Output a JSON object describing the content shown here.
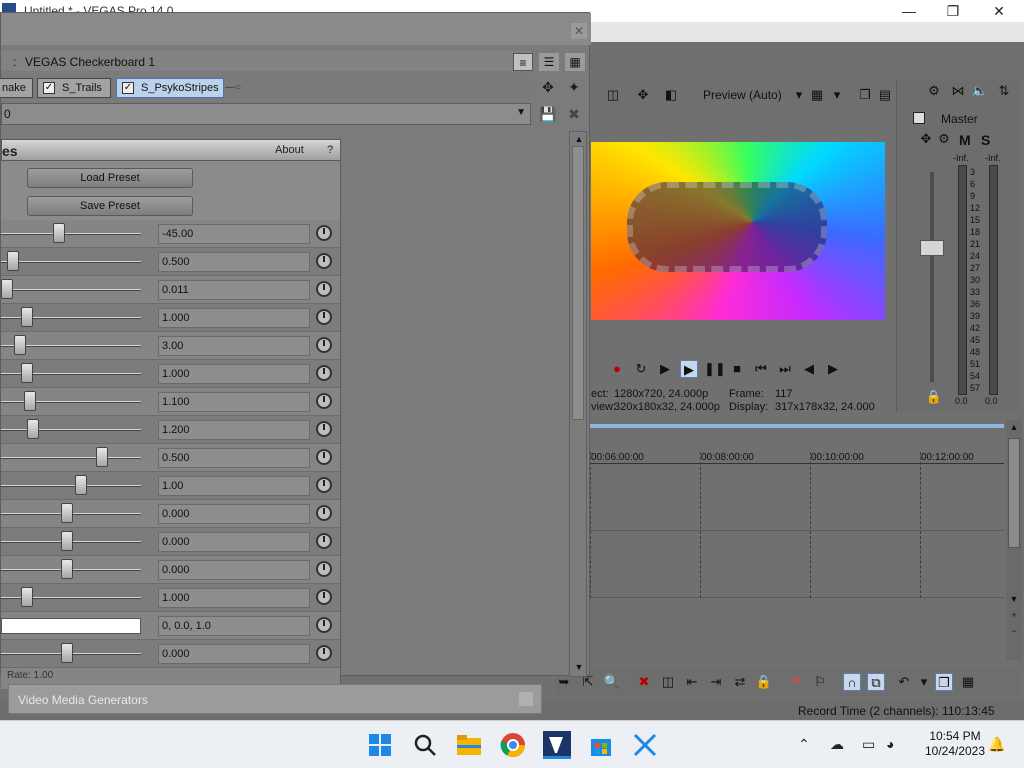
{
  "window": {
    "title": "Untitled * - VEGAS Pro 14.0"
  },
  "plugin_chain": {
    "name_prefix": ":",
    "name": "VEGAS Checkerboard 1",
    "tabs": [
      {
        "label": "nake",
        "checked": false
      },
      {
        "label": "S_Trails",
        "checked": true
      },
      {
        "label": "S_PsykoStripes",
        "checked": true,
        "active": true
      }
    ],
    "preset_value": "0"
  },
  "fx": {
    "name": "es",
    "about": "About",
    "help": "?",
    "load_preset": "Load Preset",
    "save_preset": "Save Preset",
    "params": [
      {
        "value": "-45.00",
        "level": 0.41
      },
      {
        "value": "0.500",
        "level": 0.05
      },
      {
        "value": "0.011",
        "level": 0.0
      },
      {
        "value": "1.000",
        "level": 0.16
      },
      {
        "value": "3.00",
        "level": 0.1
      },
      {
        "value": "1.000",
        "level": 0.16
      },
      {
        "value": "1.100",
        "level": 0.18
      },
      {
        "value": "1.200",
        "level": 0.2
      },
      {
        "value": "0.500",
        "level": 0.74
      },
      {
        "value": "1.00",
        "level": 0.58
      },
      {
        "value": "0.000",
        "level": 0.47
      },
      {
        "value": "0.000",
        "level": 0.47
      },
      {
        "value": "0.000",
        "level": 0.47
      },
      {
        "value": "1.000",
        "level": 0.16
      },
      {
        "value": "0, 0.0, 1.0",
        "level": null,
        "is_color": true
      },
      {
        "value": "0.000",
        "level": 0.47
      }
    ],
    "rate_label": "Rate: 1.00"
  },
  "video_media_generators": "Video Media Generators",
  "preview": {
    "label": "Preview (Auto)",
    "project_label": "ect:",
    "project_value": "1280x720, 24.000p",
    "preview_label": "view:",
    "preview_value": "320x180x32, 24.000p",
    "frame_label": "Frame:",
    "frame_value": "117",
    "display_label": "Display:",
    "display_value": "317x178x32, 24.000"
  },
  "mixer": {
    "master_label": "Master",
    "m": "M",
    "s": "S",
    "left_peak": "-Inf.",
    "right_peak": "-Inf.",
    "scale": [
      "3",
      "6",
      "9",
      "12",
      "15",
      "18",
      "21",
      "24",
      "27",
      "30",
      "33",
      "36",
      "39",
      "42",
      "45",
      "48",
      "51",
      "54",
      "57"
    ],
    "left_value": "0.0",
    "right_value": "0.0"
  },
  "timeline": {
    "ticks": [
      "00:06:00:00",
      "00:08:00:00",
      "00:10:00:00",
      "00:12:00:00"
    ]
  },
  "status": {
    "record_time": "Record Time (2 channels): 110:13:45"
  },
  "taskbar": {
    "time": "10:54 PM",
    "date": "10/24/2023"
  },
  "colors": {
    "accent": "#4d74b0",
    "active_tab": "#bcd2ec"
  }
}
